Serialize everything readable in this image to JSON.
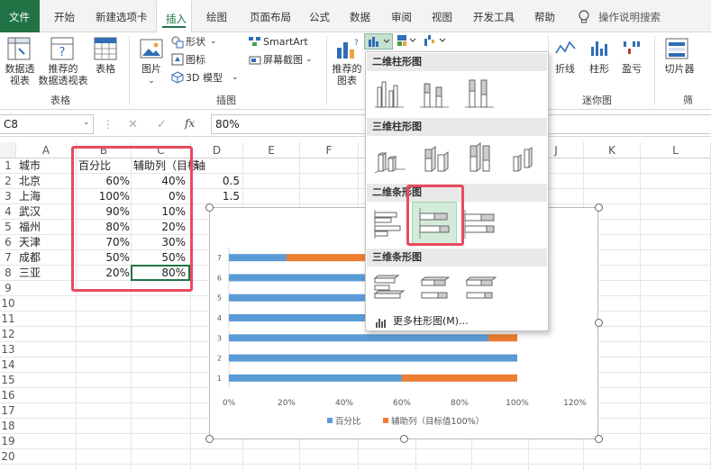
{
  "ribbon_tabs": [
    "文件",
    "开始",
    "新建选项卡",
    "插入",
    "绘图",
    "页面布局",
    "公式",
    "数据",
    "审阅",
    "视图",
    "开发工具",
    "帮助"
  ],
  "active_tab": "插入",
  "tell_me": "操作说明搜索",
  "ribbon": {
    "pivot_label_1": "数据透",
    "pivot_label_2": "视表",
    "rec_pivot_1": "推荐的",
    "rec_pivot_2": "数据透视表",
    "table": "表格",
    "group_table": "表格",
    "pictures": "图片",
    "shapes": "形状",
    "icons": "图标",
    "model3d": "3D 模型",
    "smartart": "SmartArt",
    "screenshot": "屏幕截图",
    "group_illus": "插图",
    "rec_charts_1": "推荐的",
    "rec_charts_2": "图表",
    "spark_line": "折线",
    "spark_col": "柱形",
    "spark_wl": "盈亏",
    "group_spark": "迷你图",
    "slicer": "切片器",
    "group_filter": "筛"
  },
  "formula_bar": {
    "name_box": "C8",
    "fx": "fx",
    "value": "80%"
  },
  "columns": [
    "A",
    "B",
    "C",
    "D",
    "E",
    "F",
    "G",
    "H",
    "I",
    "J",
    "K",
    "L"
  ],
  "rows": [
    "1",
    "2",
    "3",
    "4",
    "5",
    "6",
    "7",
    "8",
    "9",
    "10",
    "11",
    "12",
    "13",
    "14",
    "15",
    "16",
    "17",
    "18",
    "19",
    "20"
  ],
  "sheet": {
    "headers": [
      "城市",
      "百分比",
      "辅助列（目标"
    ],
    "extra_header": "轴",
    "data": [
      [
        "北京",
        "60%",
        "40%"
      ],
      [
        "上海",
        "100%",
        "0%"
      ],
      [
        "武汉",
        "90%",
        "10%"
      ],
      [
        "福州",
        "80%",
        "20%"
      ],
      [
        "天津",
        "70%",
        "30%"
      ],
      [
        "成都",
        "50%",
        "50%"
      ],
      [
        "三亚",
        "20%",
        "80%"
      ]
    ],
    "d_values": [
      "0.5",
      "1.5"
    ]
  },
  "dropdown": {
    "section_2d_col": "二维柱形图",
    "section_3d_col": "三维柱形图",
    "section_2d_bar": "二维条形图",
    "section_3d_bar": "三维条形图",
    "more": "更多柱形图(M)..."
  },
  "colors": {
    "excel_green": "#217346",
    "series1": "#5b9bd5",
    "series2": "#ed7d31",
    "highlight": "#e84a5f"
  },
  "chart_data": {
    "type": "bar",
    "stacked": true,
    "categories": [
      "1",
      "2",
      "3",
      "4",
      "5",
      "6",
      "7"
    ],
    "series": [
      {
        "name": "百分比",
        "values": [
          0.6,
          1.0,
          0.9,
          0.8,
          0.7,
          0.5,
          0.2
        ]
      },
      {
        "name": "辅助列（目标值100%）",
        "values": [
          0.4,
          0.0,
          0.1,
          0.2,
          0.3,
          0.5,
          0.8
        ]
      }
    ],
    "xlim": [
      0,
      1.2
    ],
    "x_ticks": [
      "0%",
      "20%",
      "40%",
      "60%",
      "80%",
      "100%",
      "120%"
    ],
    "legend_position": "bottom",
    "grid": false
  }
}
